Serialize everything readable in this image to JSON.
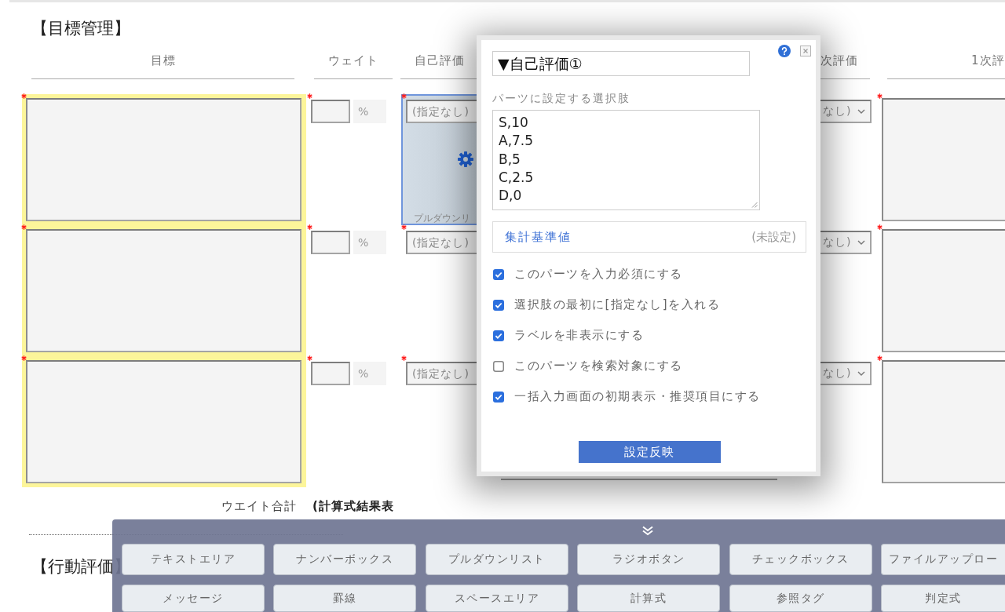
{
  "goal_section": {
    "title": "【目標管理】",
    "columns": [
      "目標",
      "ウェイト",
      "自己評価",
      "次評価",
      "1次評"
    ],
    "rows": [
      {
        "goal": {
          "required": true,
          "highlighted": true
        },
        "weight": {
          "required": true,
          "unit": "%"
        },
        "self_eval": {
          "required": true,
          "value": "(指定なし)",
          "selected": true,
          "part_label": "プルダウンリ"
        },
        "column_4": {
          "value": "なし)"
        },
        "column_5": {
          "required": true
        }
      },
      {
        "goal": {
          "required": true,
          "highlighted": true
        },
        "weight": {
          "required": true,
          "unit": "%"
        },
        "self_eval": {
          "required": true,
          "value": "(指定なし)",
          "selected": false
        },
        "column_4": {
          "value": "なし)"
        },
        "column_5": {
          "required": true
        }
      },
      {
        "goal": {
          "required": true,
          "highlighted": true
        },
        "weight": {
          "required": true,
          "unit": "%"
        },
        "self_eval": {
          "required": true,
          "value": "(指定なし)",
          "selected": false
        },
        "column_4": {
          "value": "なし)"
        },
        "column_5": {
          "required": true
        }
      }
    ],
    "total": {
      "label": "ウエイト合計",
      "value": "(計算式結果表"
    }
  },
  "behavior_section": {
    "title": "【行動評価】"
  },
  "dialog": {
    "title": "▼自己評価①",
    "choices_label": "パーツに設定する選択肢",
    "choices": [
      "S,10",
      "A,7.5",
      "B,5",
      "C,2.5",
      "D,0"
    ],
    "aggregate": {
      "label": "集計基準値",
      "status": "(未設定)"
    },
    "options": [
      {
        "label": "このパーツを入力必須にする",
        "checked": true
      },
      {
        "label": "選択肢の最初に[指定なし]を入れる",
        "checked": true
      },
      {
        "label": "ラベルを非表示にする",
        "checked": true
      },
      {
        "label": "このパーツを検索対象にする",
        "checked": false
      },
      {
        "label": "一括入力画面の初期表示・推奨項目にする",
        "checked": true
      }
    ],
    "apply_button": "設定反映"
  },
  "palette": {
    "rows": [
      [
        "テキストエリア",
        "ナンバーボックス",
        "プルダウンリスト",
        "ラジオボタン",
        "チェックボックス",
        "ファイルアップロー"
      ],
      [
        "メッセージ",
        "罫線",
        "スペースエリア",
        "計算式",
        "参照タグ",
        "判定式"
      ]
    ]
  }
}
